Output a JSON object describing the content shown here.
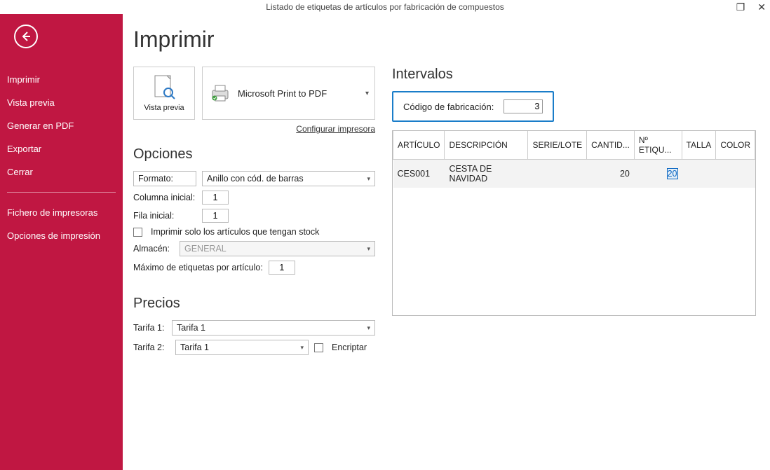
{
  "window": {
    "title": "Listado de etiquetas de artículos por fabricación de compuestos"
  },
  "sidebar": {
    "items": [
      "Imprimir",
      "Vista previa",
      "Generar en PDF",
      "Exportar",
      "Cerrar"
    ],
    "secondary": [
      "Fichero de impresoras",
      "Opciones de impresión"
    ]
  },
  "page": {
    "title": "Imprimir",
    "vista_previa": "Vista previa",
    "printer": "Microsoft Print to PDF",
    "config_link": "Configurar impresora"
  },
  "options": {
    "heading": "Opciones",
    "formato_label": "Formato:",
    "formato_value": "Anillo con cód. de barras",
    "columna_label": "Columna inicial:",
    "columna_value": "1",
    "fila_label": "Fila inicial:",
    "fila_value": "1",
    "stock_label": "Imprimir solo los artículos que tengan stock",
    "almacen_label": "Almacén:",
    "almacen_value": "GENERAL",
    "max_label": "Máximo de etiquetas por artículo:",
    "max_value": "1"
  },
  "prices": {
    "heading": "Precios",
    "tarifa1_label": "Tarifa 1:",
    "tarifa1_value": "Tarifa 1",
    "tarifa2_label": "Tarifa 2:",
    "tarifa2_value": "Tarifa 1",
    "encriptar_label": "Encriptar"
  },
  "intervals": {
    "heading": "Intervalos",
    "codigo_label": "Código de fabricación:",
    "codigo_value": "3",
    "columns": [
      "ARTÍCULO",
      "DESCRIPCIÓN",
      "SERIE/LOTE",
      "CANTID...",
      "Nº ETIQU...",
      "TALLA",
      "COLOR"
    ],
    "rows": [
      {
        "articulo": "CES001",
        "descripcion": "CESTA DE NAVIDAD",
        "serie": "",
        "cantidad": "20",
        "n_etiq": "20",
        "talla": "",
        "color": ""
      }
    ]
  }
}
